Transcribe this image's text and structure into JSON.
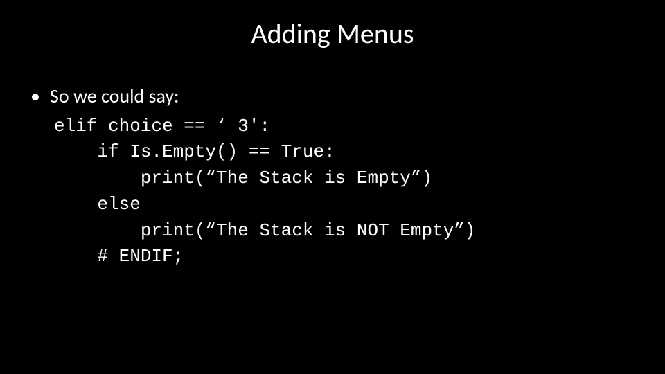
{
  "title": "Adding Menus",
  "bullet": {
    "dot": "•",
    "text": "So we could say:"
  },
  "code": {
    "line1": "elif choice == ‘ 3':",
    "line2": "    if Is.Empty() == True:",
    "line3": "        print(“The Stack is Empty”)",
    "line4": "    else",
    "line5": "        print(“The Stack is NOT Empty”)",
    "line6": "    # ENDIF;"
  }
}
